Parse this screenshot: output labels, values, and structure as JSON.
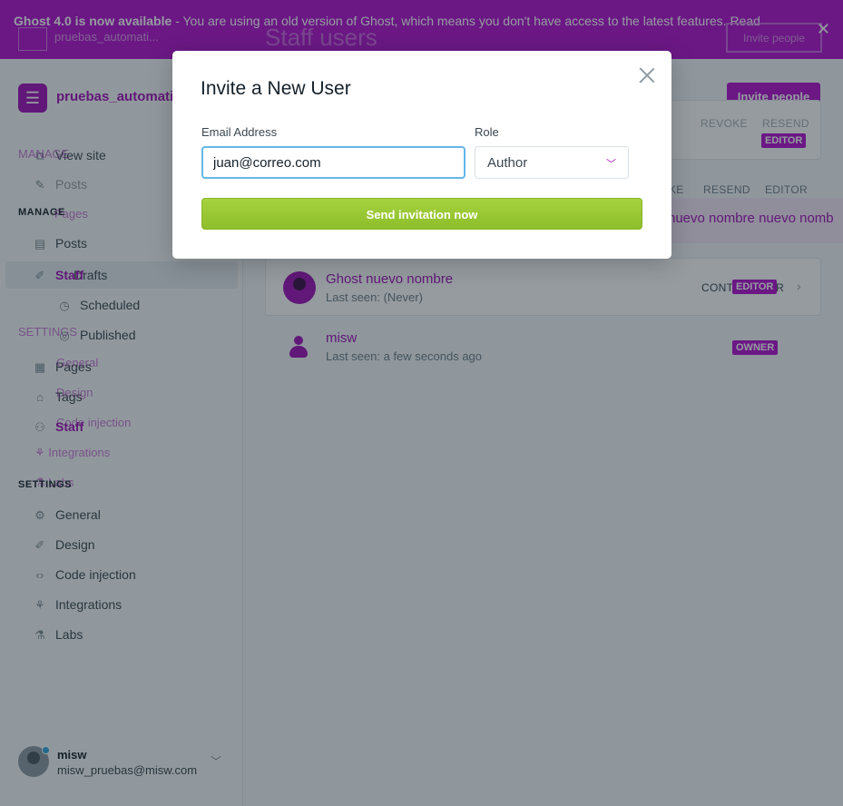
{
  "banner": {
    "bold_text": "Ghost 4.0 is now available",
    "text": " - You are using an old version of Ghost, which means you don't have access to the latest features. Read",
    "ghost_site": "pruebas_automati...",
    "ghost_title": "Staff users",
    "ghost_button": "Invite people"
  },
  "sidebar": {
    "brand_name": "pruebas_automati",
    "view_site": "View site",
    "posts": "Posts",
    "manage_label": "MANAGE",
    "pages": "Pages",
    "drafts": "Drafts",
    "scheduled": "Scheduled",
    "published": "Published",
    "pages2": "Pages",
    "tags": "Tags",
    "staff": "Staff",
    "settings_label": "SETTINGS",
    "general": "General",
    "design": "Design",
    "code_injection": "Code injection",
    "integrations": "Integrations",
    "labs": "Labs",
    "ghost_items": [
      "Posts",
      "Pages",
      "Staff",
      "Tags",
      "General",
      "Design",
      "Code injection",
      "Integrations",
      "Labs"
    ]
  },
  "user": {
    "name": "misw",
    "email": "misw_pruebas@misw.com"
  },
  "main": {
    "invite_button": "Invite people",
    "revoke": "REVOKE",
    "resend": "RESEND",
    "editor_badge": "EDITOR",
    "revoke2": "KE",
    "resend2": "RESEND",
    "editor2": "EDITOR",
    "pink_row_text": "nuevo nombre nuevo nomb",
    "users": [
      {
        "name": "Ghost nuevo nombre",
        "sub": "Last seen: (Never)",
        "role_text": "CONTRIBUTOR",
        "badge": "EDITOR"
      },
      {
        "name": "misw",
        "sub": "Last seen: a few seconds ago",
        "badge": "OWNER"
      }
    ]
  },
  "modal": {
    "title": "Invite a New User",
    "email_label": "Email Address",
    "email_value": "juan@correo.com",
    "role_label": "Role",
    "role_value": "Author",
    "send_button": "Send invitation now"
  },
  "colors": {
    "brand": "#a112b8",
    "banner": "#b312cf",
    "send_button": "#9ac936",
    "input_focus": "#64b6e8"
  }
}
